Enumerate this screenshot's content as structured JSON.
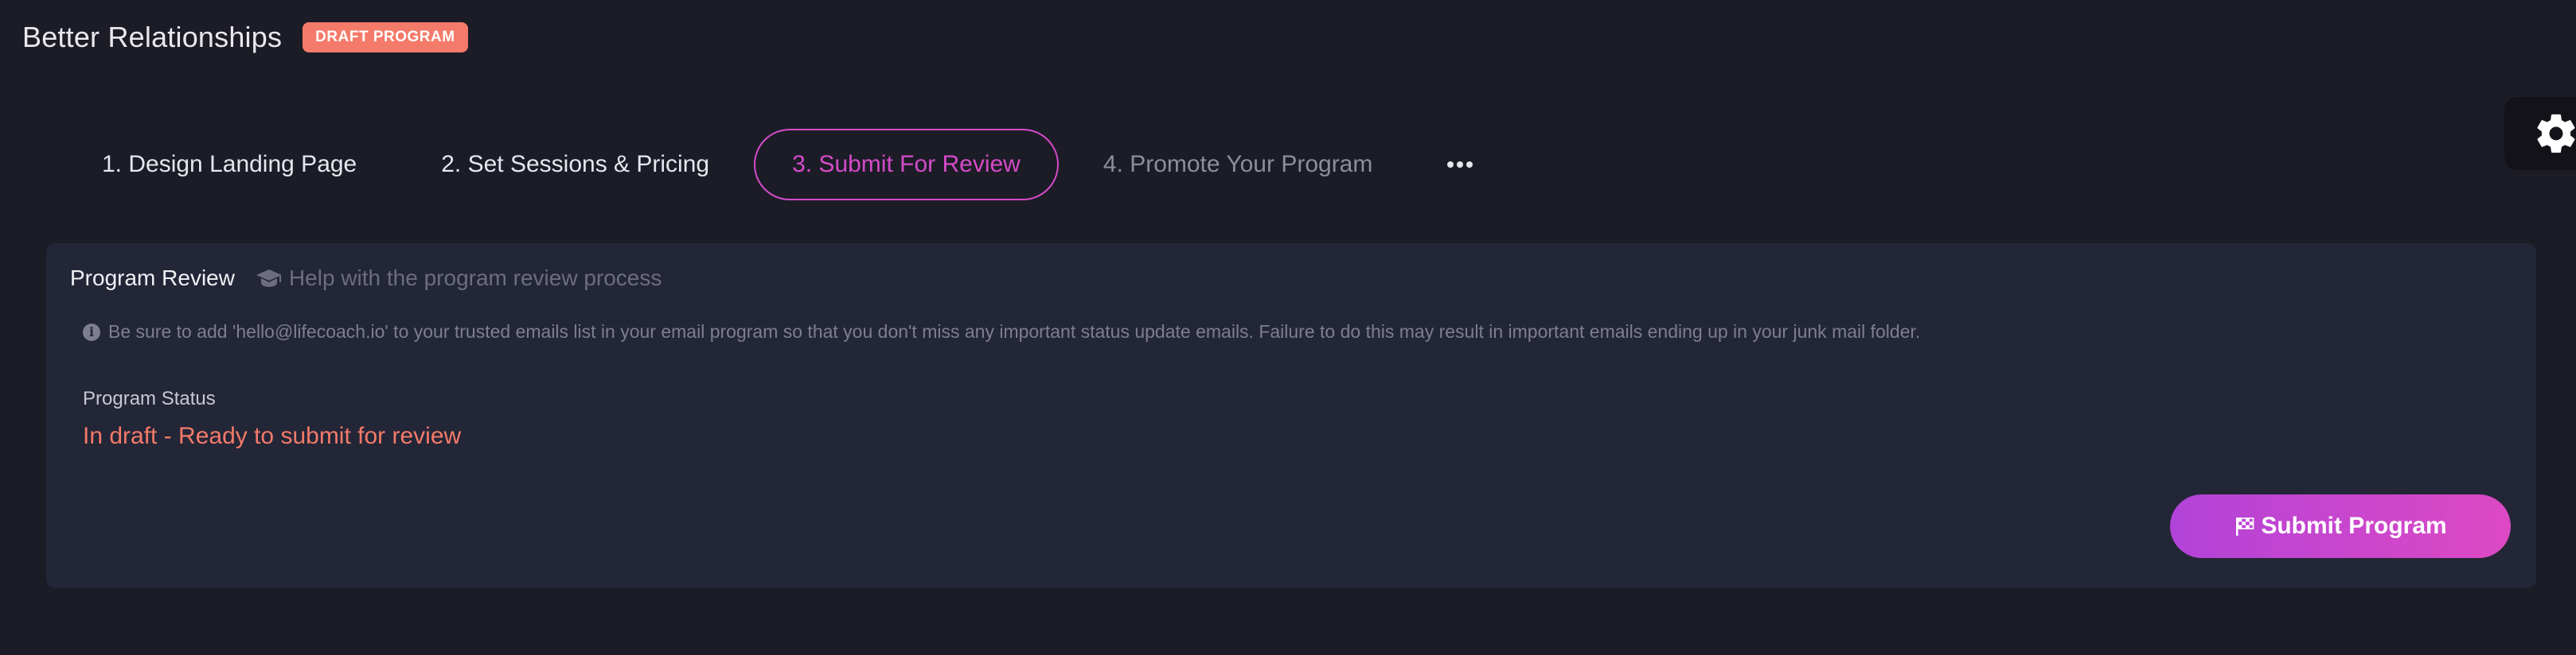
{
  "header": {
    "program_title": "Better Relationships",
    "badge": "DRAFT PROGRAM"
  },
  "tabs": [
    {
      "label": "1. Design Landing Page",
      "state": "completed"
    },
    {
      "label": "2. Set Sessions & Pricing",
      "state": "completed"
    },
    {
      "label": "3. Submit For Review",
      "state": "active"
    },
    {
      "label": "4. Promote Your Program",
      "state": "future"
    }
  ],
  "more_menu_icon": "ellipsis-icon",
  "settings_icon": "gear-icon",
  "panel": {
    "title": "Program Review",
    "help_icon": "graduation-cap-icon",
    "help_link": "Help with the program review process",
    "notice_icon": "info-icon",
    "notice": "Be sure to add 'hello@lifecoach.io' to your trusted emails list in your email program so that you don't miss any important status update emails. Failure to do this may result in important emails ending up in your junk mail folder.",
    "status_label": "Program Status",
    "status_value": "In draft - Ready to submit for review",
    "submit_icon": "checkered-flag-icon",
    "submit_label": "Submit Program"
  },
  "colors": {
    "background": "#1c1c27",
    "panel": "#232637",
    "accent": "#d44bc8",
    "badge": "#f47a69",
    "status": "#f47a69",
    "button_gradient_start": "#b243d8",
    "button_gradient_end": "#dd49c3"
  }
}
